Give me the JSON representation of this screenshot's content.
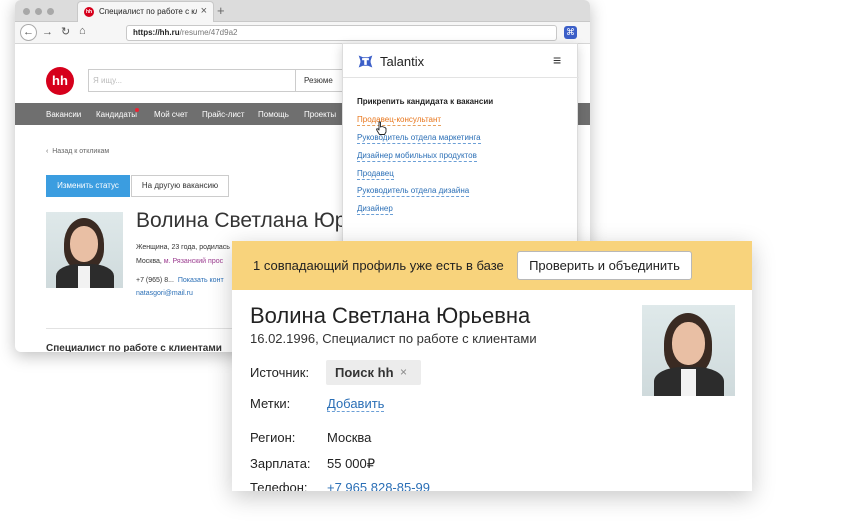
{
  "browser": {
    "tab_title": "Специалист по работе с клиен",
    "tab_favicon": "hh",
    "url_host": "https://hh.ru",
    "url_path": "/resume/47d9a2"
  },
  "hh": {
    "logo": "hh",
    "search_placeholder": "Я ищу...",
    "search_scope": "Резюме",
    "nav": [
      "Вакансии",
      "Кандидаты",
      "Мой счет",
      "Прайс-лист",
      "Помощь",
      "Проекты"
    ],
    "back_link": "Назад к откликам",
    "change_status": "Изменить статус",
    "other_vacancy": "На другую вакансию",
    "name": "Волина Светлана Юрьевна",
    "info_line": "Женщина, 23 года, родилась",
    "city_prefix": "Москва,",
    "metro": "м. Рязанский прос",
    "phone": "+7 (965) 8...",
    "show_contacts": "Показать конт",
    "email": "natasgori@mail.ru",
    "job_title": "Специалист по работе с клиентами"
  },
  "talantix": {
    "brand": "Talantix",
    "heading": "Прикрепить кандидата к вакансии",
    "vacancies": [
      "Продавец-консультант",
      "Руководитель отдела маркетинга",
      "Дизайнер мобильных продуктов",
      "Продавец",
      "Руководитель отдела дизайна",
      "Дизайнер"
    ]
  },
  "card": {
    "banner_text": "1 совпадающий профиль уже есть в базе",
    "banner_button": "Проверить и объединить",
    "name": "Волина Светлана Юрьевна",
    "subtitle": "16.02.1996, Специалист по работе с клиентами",
    "source_label": "Источник:",
    "source_value": "Поиск hh",
    "tags_label": "Метки:",
    "tags_add": "Добавить",
    "region_label": "Регион:",
    "region_value": "Москва",
    "salary_label": "Зарплата:",
    "salary_value": "55 000₽",
    "phone_label": "Телефон:",
    "phone_value": "+7 965 828-85-99"
  },
  "colors": {
    "hh_red": "#d6001c",
    "talantix_blue": "#3c5fc8",
    "link_blue": "#2b6fb6",
    "active_orange": "#e8761c",
    "banner_yellow": "#f8d37c",
    "button_blue": "#3b9de0"
  }
}
